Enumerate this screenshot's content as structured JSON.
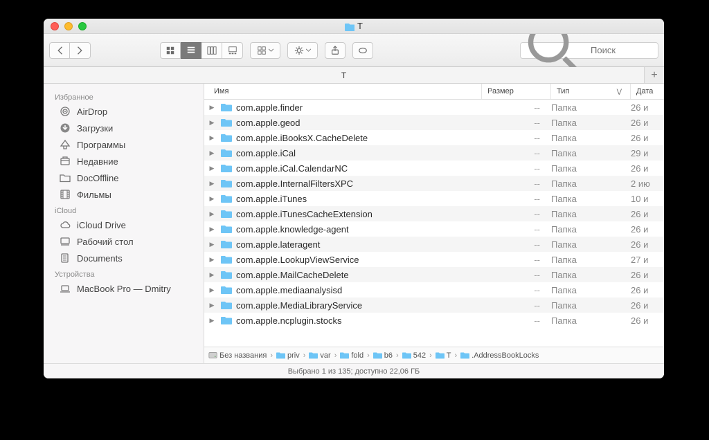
{
  "window": {
    "title": "T"
  },
  "search": {
    "placeholder": "Поиск"
  },
  "tab": {
    "label": "T"
  },
  "sidebar": {
    "favorites_heading": "Избранное",
    "favorites": [
      {
        "label": "AirDrop",
        "icon": "airdrop"
      },
      {
        "label": "Загрузки",
        "icon": "download"
      },
      {
        "label": "Программы",
        "icon": "apps"
      },
      {
        "label": "Недавние",
        "icon": "recent"
      },
      {
        "label": "DocOffline",
        "icon": "folder"
      },
      {
        "label": "Фильмы",
        "icon": "film"
      }
    ],
    "icloud_heading": "iCloud",
    "icloud": [
      {
        "label": "iCloud Drive",
        "icon": "cloud"
      },
      {
        "label": "Рабочий стол",
        "icon": "desktop"
      },
      {
        "label": "Documents",
        "icon": "docs"
      }
    ],
    "devices_heading": "Устройства",
    "devices": [
      {
        "label": "MacBook Pro — Dmitry",
        "icon": "laptop"
      }
    ]
  },
  "columns": {
    "name": "Имя",
    "size": "Размер",
    "kind": "Тип",
    "date": "Дата"
  },
  "files": [
    {
      "name": "com.apple.finder",
      "size": "--",
      "kind": "Папка",
      "date": "26 и"
    },
    {
      "name": "com.apple.geod",
      "size": "--",
      "kind": "Папка",
      "date": "26 и"
    },
    {
      "name": "com.apple.iBooksX.CacheDelete",
      "size": "--",
      "kind": "Папка",
      "date": "26 и"
    },
    {
      "name": "com.apple.iCal",
      "size": "--",
      "kind": "Папка",
      "date": "29 и"
    },
    {
      "name": "com.apple.iCal.CalendarNC",
      "size": "--",
      "kind": "Папка",
      "date": "26 и"
    },
    {
      "name": "com.apple.InternalFiltersXPC",
      "size": "--",
      "kind": "Папка",
      "date": "2 ию"
    },
    {
      "name": "com.apple.iTunes",
      "size": "--",
      "kind": "Папка",
      "date": "10 и"
    },
    {
      "name": "com.apple.iTunesCacheExtension",
      "size": "--",
      "kind": "Папка",
      "date": "26 и"
    },
    {
      "name": "com.apple.knowledge-agent",
      "size": "--",
      "kind": "Папка",
      "date": "26 и"
    },
    {
      "name": "com.apple.lateragent",
      "size": "--",
      "kind": "Папка",
      "date": "26 и"
    },
    {
      "name": "com.apple.LookupViewService",
      "size": "--",
      "kind": "Папка",
      "date": "27 и"
    },
    {
      "name": "com.apple.MailCacheDelete",
      "size": "--",
      "kind": "Папка",
      "date": "26 и"
    },
    {
      "name": "com.apple.mediaanalysisd",
      "size": "--",
      "kind": "Папка",
      "date": "26 и"
    },
    {
      "name": "com.apple.MediaLibraryService",
      "size": "--",
      "kind": "Папка",
      "date": "26 и"
    },
    {
      "name": "com.apple.ncplugin.stocks",
      "size": "--",
      "kind": "Папка",
      "date": "26 и"
    }
  ],
  "path": [
    {
      "label": "Без названия",
      "icon": "hdd"
    },
    {
      "label": "priv",
      "icon": "folder"
    },
    {
      "label": "var",
      "icon": "folder"
    },
    {
      "label": "fold",
      "icon": "folder"
    },
    {
      "label": "b6",
      "icon": "folder"
    },
    {
      "label": "542",
      "icon": "folder"
    },
    {
      "label": "T",
      "icon": "folder"
    },
    {
      "label": ".AddressBookLocks",
      "icon": "folder"
    }
  ],
  "status": {
    "text": "Выбрано 1 из 135; доступно 22,06 ГБ"
  }
}
